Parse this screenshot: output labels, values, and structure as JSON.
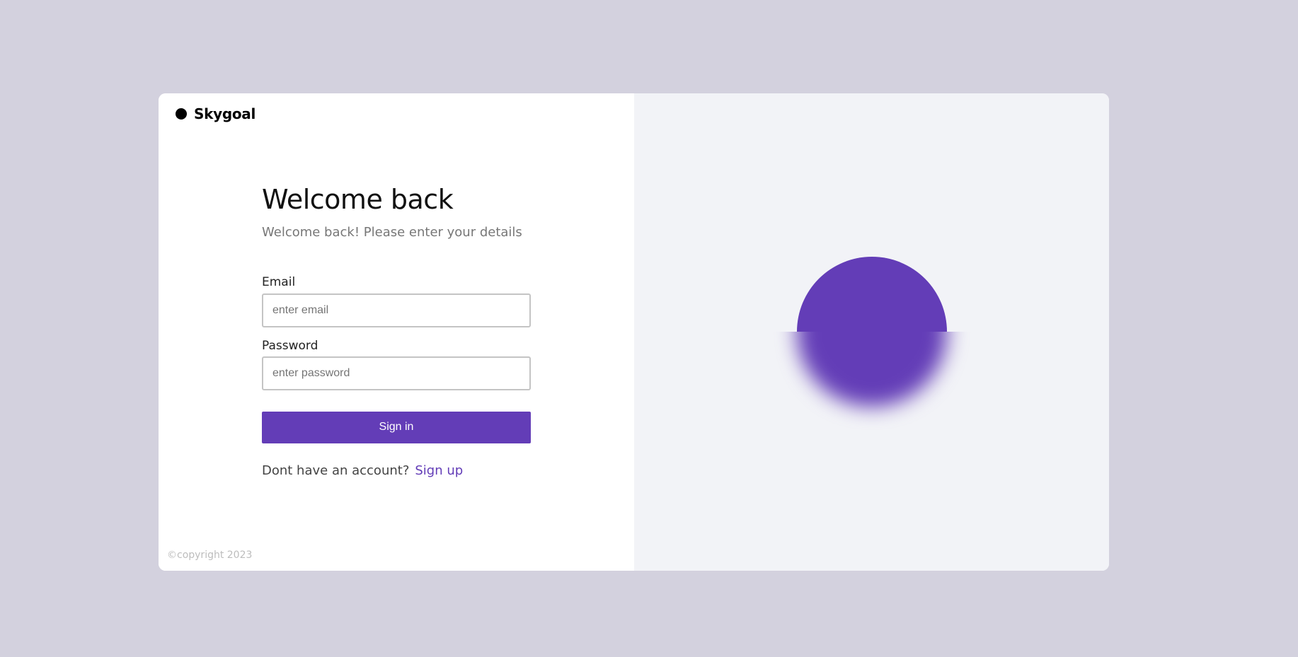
{
  "brand": {
    "name": "Skygoal"
  },
  "login": {
    "title": "Welcome back",
    "subtitle": "Welcome back! Please enter your details",
    "email_label": "Email",
    "email_placeholder": "enter email",
    "email_value": "",
    "password_label": "Password",
    "password_placeholder": "enter password",
    "password_value": "",
    "signin_label": "Sign in",
    "signup_prompt": "Dont have an account?",
    "signup_link": "Sign up"
  },
  "footer": {
    "copyright": "©copyright 2023"
  },
  "colors": {
    "page_background": "#d3d1de",
    "accent": "#633db7",
    "right_panel_background": "#f2f3f7"
  },
  "icons": {
    "brand_logo": "filled-circle-logo-icon",
    "illustration": "purple-circle-orb"
  }
}
